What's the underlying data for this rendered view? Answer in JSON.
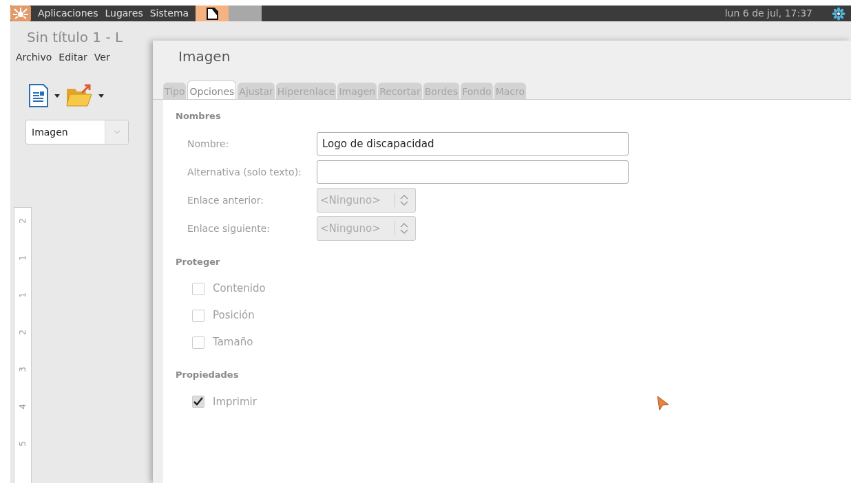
{
  "panel": {
    "menus": [
      "Aplicaciones",
      "Lugares",
      "Sistema"
    ],
    "clock": "lun  6 de jul, 17:37"
  },
  "writer": {
    "title": "Sin título 1 - L",
    "menu": [
      "Archivo",
      "Editar",
      "Ver"
    ],
    "style_box": "Imagen",
    "ruler_labels": [
      "2",
      "1",
      "1",
      "2",
      "3",
      "4",
      "5"
    ]
  },
  "dialog": {
    "title": "Imagen",
    "tabs": [
      {
        "label": "Tipo",
        "selected": false
      },
      {
        "label": "Opciones",
        "selected": true
      },
      {
        "label": "Ajustar",
        "selected": false
      },
      {
        "label": "Hiperenlace",
        "selected": false
      },
      {
        "label": "Imagen",
        "selected": false
      },
      {
        "label": "Recortar",
        "selected": false
      },
      {
        "label": "Bordes",
        "selected": false
      },
      {
        "label": "Fondo",
        "selected": false
      },
      {
        "label": "Macro",
        "selected": false
      }
    ],
    "sections": [
      {
        "heading": "Nombres",
        "rows": [
          {
            "kind": "text",
            "label": "Nombre:",
            "value": "Logo de discapacidad",
            "disabled": false
          },
          {
            "kind": "text",
            "label": "Alternativa (solo texto):",
            "disabled": false
          },
          {
            "kind": "spin",
            "label": "Enlace anterior:",
            "value": "<Ninguno>",
            "disabled": true
          },
          {
            "kind": "spin",
            "label": "Enlace siguiente:",
            "value": "<Ninguno>",
            "disabled": true
          }
        ]
      },
      {
        "heading": "Proteger",
        "rows": [
          {
            "kind": "check",
            "label": "Contenido",
            "checked": false,
            "disabled": true
          },
          {
            "kind": "check",
            "label": "Posición",
            "checked": false,
            "disabled": true
          },
          {
            "kind": "check",
            "label": "Tamaño",
            "checked": false,
            "disabled": true
          }
        ]
      },
      {
        "heading": "Propiedades",
        "rows": [
          {
            "kind": "check",
            "label": "Imprimir",
            "checked": true,
            "disabled": true
          }
        ]
      }
    ]
  }
}
